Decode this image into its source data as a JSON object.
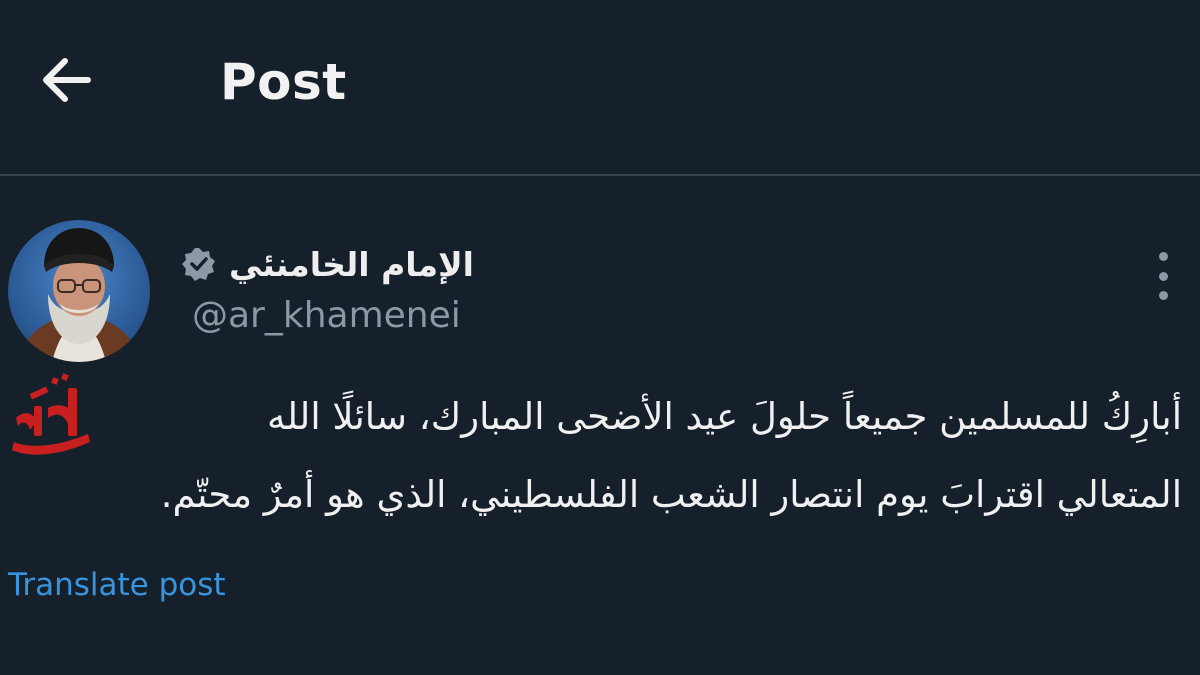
{
  "header": {
    "title": "Post",
    "back_icon": "arrow-left-icon"
  },
  "post": {
    "author": {
      "display_name": "الإمام الخامنئي",
      "handle": "@ar_khamenei",
      "verified": true,
      "verified_icon": "verified-badge-icon"
    },
    "more_icon": "more-vertical-icon",
    "text_lines": [
      "أبارِكُ للمسلمين جميعاً حلولَ عيد الأضحى المبارك، سائلًا الله",
      "المتعالي اقترابَ يوم انتصار الشعب الفلسطيني، الذي هو أمرٌ محتّم."
    ],
    "watermark_text": "نگار",
    "translate_label": "Translate post"
  },
  "colors": {
    "background": "#15202b",
    "divider": "#38444d",
    "text_primary": "#f0f0f0",
    "text_secondary": "#8b98a5",
    "link": "#3a94dd",
    "watermark": "#c8201f"
  }
}
